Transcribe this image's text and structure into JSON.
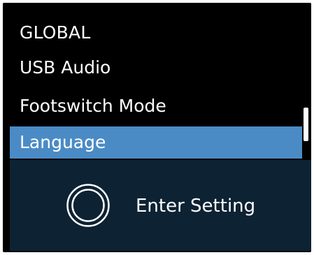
{
  "menu": {
    "title": "GLOBAL",
    "items": [
      {
        "label": "USB Audio",
        "selected": false
      },
      {
        "label": "Footswitch Mode",
        "selected": false
      },
      {
        "label": "Language",
        "selected": true
      }
    ]
  },
  "action": {
    "icon": "knob-press-icon",
    "label": "Enter Setting"
  },
  "colors": {
    "screen_background": "#000000",
    "selection": "#4a8bc6",
    "action_panel": "#0d2233",
    "text": "#ffffff"
  }
}
